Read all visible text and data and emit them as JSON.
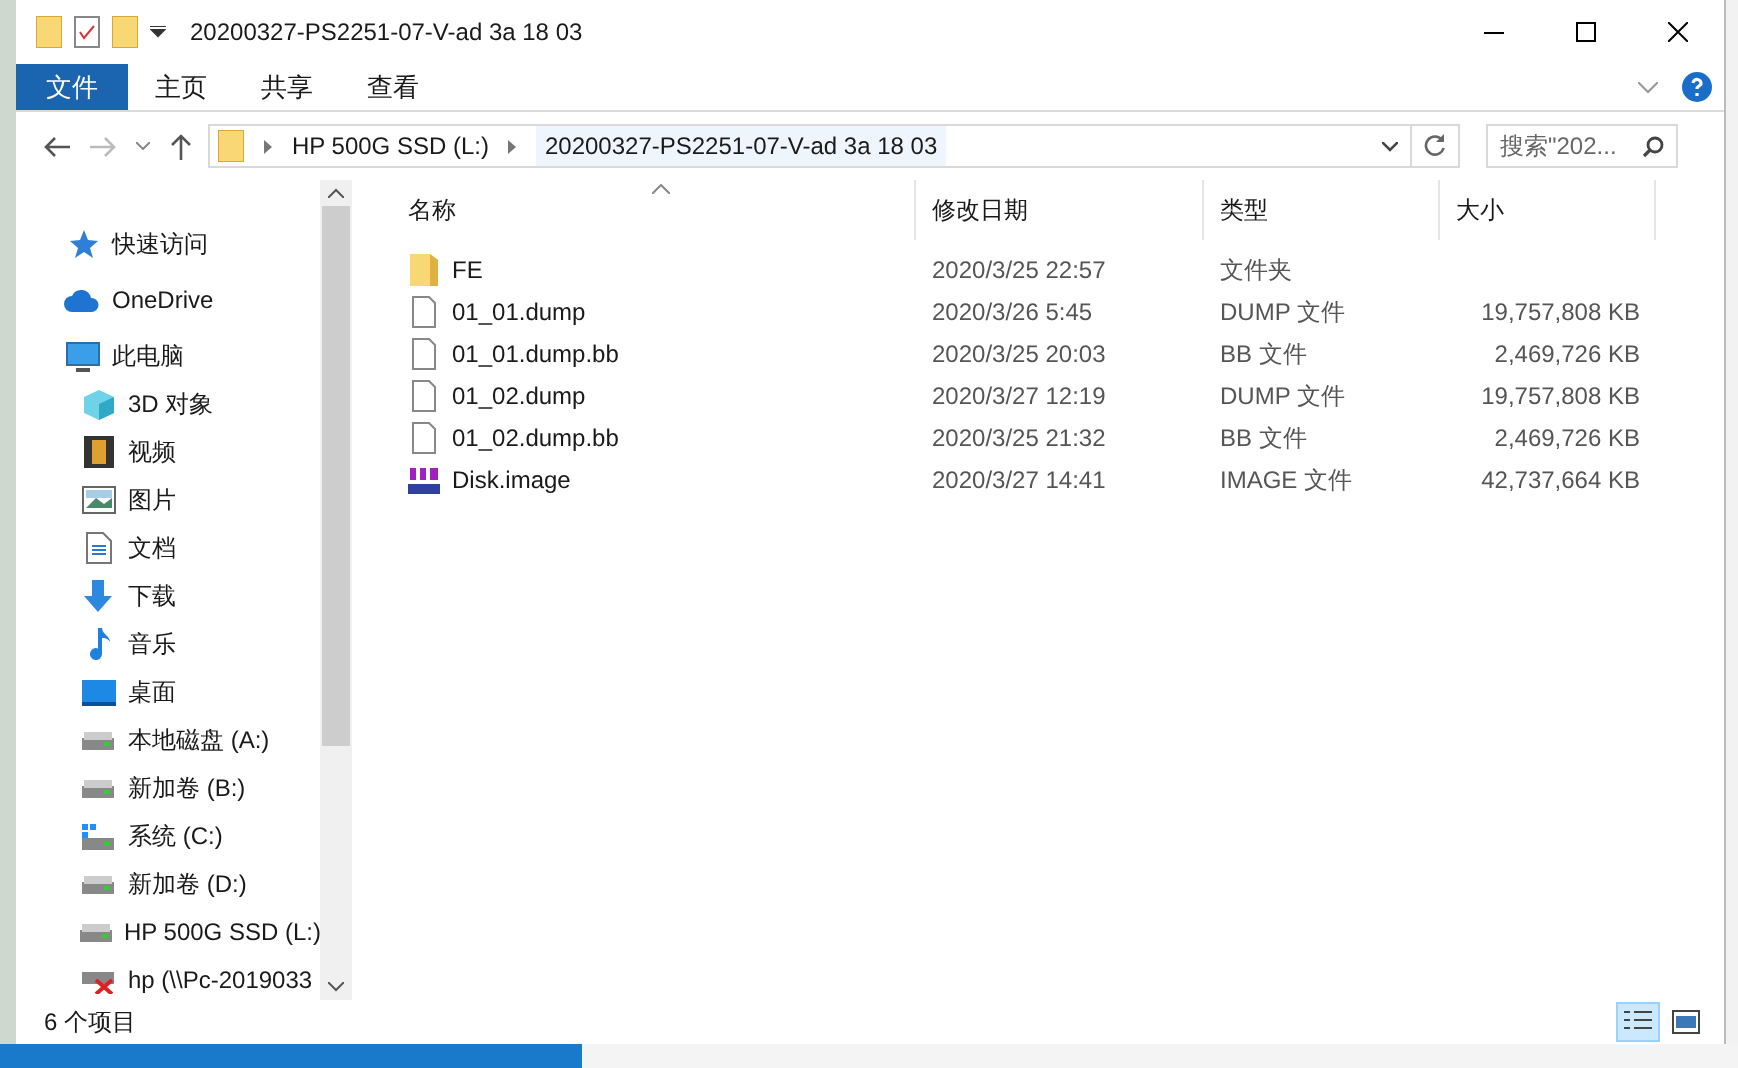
{
  "window": {
    "title": "20200327-PS2251-07-V-ad 3a 18 03"
  },
  "ribbon_tabs": [
    {
      "label": "文件",
      "selected": true
    },
    {
      "label": "主页",
      "selected": false
    },
    {
      "label": "共享",
      "selected": false
    },
    {
      "label": "查看",
      "selected": false
    }
  ],
  "address": {
    "breadcrumbs": [
      "HP 500G SSD (L:)",
      "20200327-PS2251-07-V-ad 3a 18 03"
    ]
  },
  "search": {
    "placeholder": "搜索\"202..."
  },
  "sidebar": {
    "items": [
      {
        "label": "快速访问",
        "kind": "star"
      },
      {
        "label": "OneDrive",
        "kind": "cloud"
      },
      {
        "label": "此电脑",
        "kind": "pc",
        "children": [
          {
            "label": "3D 对象",
            "kind": "cube"
          },
          {
            "label": "视频",
            "kind": "film"
          },
          {
            "label": "图片",
            "kind": "image"
          },
          {
            "label": "文档",
            "kind": "doc"
          },
          {
            "label": "下载",
            "kind": "download"
          },
          {
            "label": "音乐",
            "kind": "music"
          },
          {
            "label": "桌面",
            "kind": "desktop"
          },
          {
            "label": "本地磁盘 (A:)",
            "kind": "drive"
          },
          {
            "label": "新加卷 (B:)",
            "kind": "drive"
          },
          {
            "label": "系统 (C:)",
            "kind": "sysdrive"
          },
          {
            "label": "新加卷 (D:)",
            "kind": "drive"
          },
          {
            "label": "HP 500G SSD (L:)",
            "kind": "drive"
          },
          {
            "label": "hp (\\\\Pc-2019033",
            "kind": "netdrive"
          }
        ]
      }
    ]
  },
  "table": {
    "columns": [
      "名称",
      "修改日期",
      "类型",
      "大小"
    ],
    "rows": [
      {
        "name": "FE",
        "date": "2020/3/25 22:57",
        "type": "文件夹",
        "kind": "folder"
      },
      {
        "name": "01_01.dump",
        "date": "2020/3/26 5:45",
        "type": "DUMP 文件",
        "size": "19,757,808 KB",
        "kind": "file"
      },
      {
        "name": "01_01.dump.bb",
        "date": "2020/3/25 20:03",
        "type": "BB 文件",
        "size": "2,469,726 KB",
        "kind": "file"
      },
      {
        "name": "01_02.dump",
        "date": "2020/3/27 12:19",
        "type": "DUMP 文件",
        "size": "19,757,808 KB",
        "kind": "file"
      },
      {
        "name": "01_02.dump.bb",
        "date": "2020/3/25 21:32",
        "type": "BB 文件",
        "size": "2,469,726 KB",
        "kind": "file"
      },
      {
        "name": "Disk.image",
        "date": "2020/3/27 14:41",
        "type": "IMAGE 文件",
        "size": "42,737,664 KB",
        "kind": "hex"
      }
    ]
  },
  "status_bar": {
    "text": "6 个项目",
    "views": [
      {
        "kind": "details",
        "selected": true
      },
      {
        "kind": "thumbnails",
        "selected": false
      }
    ]
  }
}
